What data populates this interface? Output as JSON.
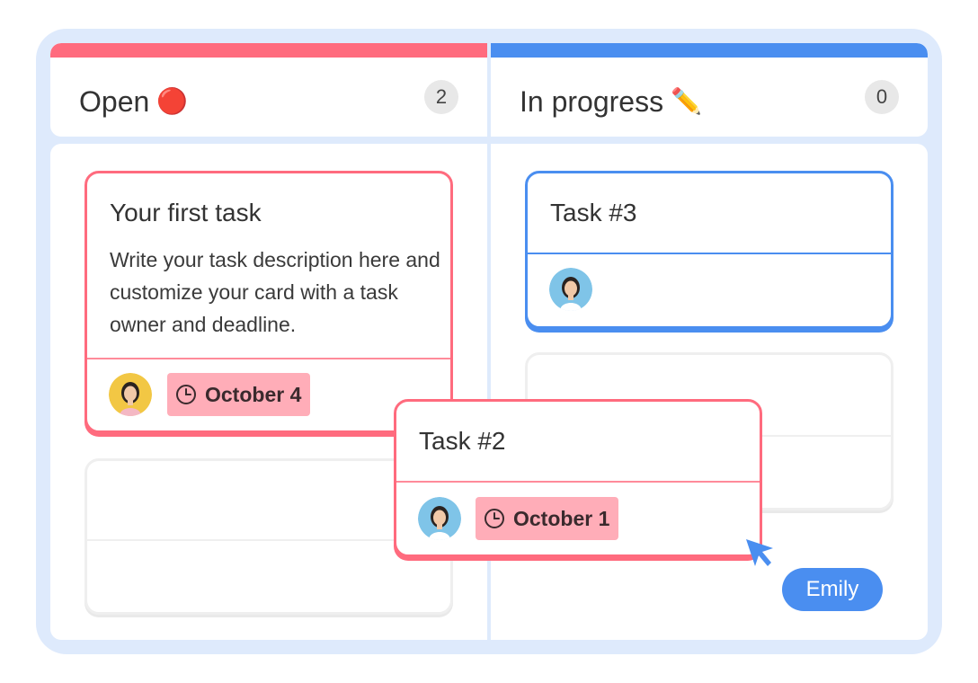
{
  "columns": {
    "open": {
      "title": "Open",
      "emoji": "🔴",
      "count": "2",
      "color": "#ff6b7e"
    },
    "in_progress": {
      "title": "In progress",
      "emoji": "✏️",
      "count": "0",
      "color": "#4a8ef0"
    }
  },
  "cards": {
    "first": {
      "title": "Your first task",
      "description": "Write your task description here and customize your card with a task owner and deadline.",
      "date": "October 4"
    },
    "task3": {
      "title": "Task #3"
    },
    "task2": {
      "title": "Task #2",
      "date": "October 1"
    }
  },
  "cursor": {
    "label": "Emily",
    "color": "#4a8ef0"
  },
  "icons": {
    "clock": "clock-icon",
    "cursor": "pointer-cursor-icon",
    "open_status": "red-circle-icon",
    "progress_status": "pencil-icon"
  }
}
